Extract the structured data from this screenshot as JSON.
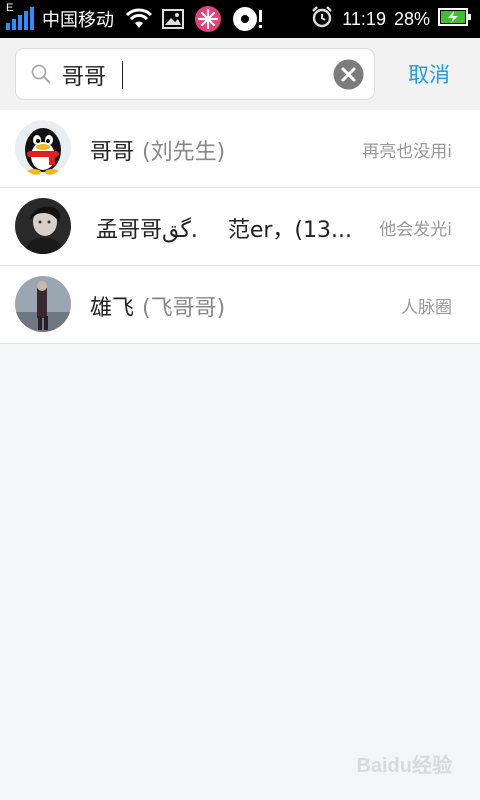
{
  "status_bar": {
    "network_type": "E",
    "carrier": "中国移动",
    "time": "11:19",
    "battery_percent": "28%",
    "icons": [
      "signal-icon",
      "wifi-icon",
      "image-icon",
      "snowflake-icon",
      "music-disc-icon",
      "alarm-icon",
      "battery-charging-icon"
    ]
  },
  "search": {
    "query": "哥哥",
    "cancel_label": "取消"
  },
  "results": [
    {
      "name": "哥哥",
      "sub": "(刘先生)",
      "source": "再亮也没用i",
      "avatar": "qq-penguin-avatar"
    },
    {
      "name": "孟哥哥گق.",
      "sub": "范er，(13...",
      "source": "他会发光i",
      "avatar": "photo-avatar"
    },
    {
      "name": "雄飞",
      "sub": "(飞哥哥)",
      "source": "人脉圈",
      "avatar": "photo-avatar"
    }
  ],
  "watermark": "Baidu经验",
  "colors": {
    "accent": "#1ba0e2",
    "status_bar": "#000000",
    "background": "#f4f5f7"
  }
}
